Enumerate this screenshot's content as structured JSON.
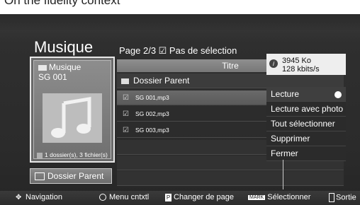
{
  "banner": {
    "text": "On the fidelity context"
  },
  "header": {
    "title": "Musique",
    "page_indicator": "Page 2/3  ☑  Pas de sélection"
  },
  "thumbnail": {
    "folder_label": "Musique",
    "item_name": "SG 001",
    "count_text": "1 dossier(s), 3 fichier(s)"
  },
  "sidebar": {
    "parent_button_label": "Dossier Parent"
  },
  "table": {
    "column_header": "Titre",
    "parent_row_label": "Dossier Parent",
    "rows": [
      {
        "check": "☑",
        "name": "SG 001,mp3",
        "selected": true
      },
      {
        "check": "☑",
        "name": "SG 002,mp3",
        "selected": false
      },
      {
        "check": "☑",
        "name": "SG 003,mp3",
        "selected": false
      }
    ]
  },
  "info": {
    "size": "3945 Ko",
    "bitrate": "128 kbits/s"
  },
  "context_menu": {
    "items": [
      {
        "label": "Lecture",
        "active": true
      },
      {
        "label": "Lecture avec photo",
        "active": false
      },
      {
        "label": "Tout sélectionner",
        "active": false
      },
      {
        "label": "Supprimer",
        "active": false
      },
      {
        "label": "Fermer",
        "active": false
      }
    ]
  },
  "footer": {
    "navigation": "Navigation",
    "menu": "Menu cntxtl",
    "page_icon_text": "P",
    "page_change": "Changer de page",
    "mark_icon_text": "MARK",
    "select": "Sélectionner",
    "exit": "Sortie"
  }
}
